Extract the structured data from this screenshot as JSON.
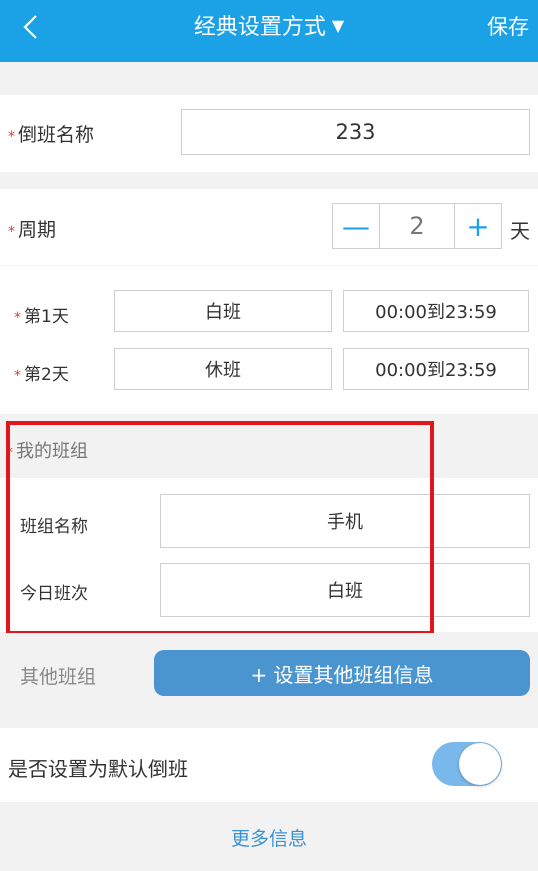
{
  "header": {
    "title": "经典设置方式",
    "title_caret": "▼",
    "save_label": "保存"
  },
  "shift_name": {
    "required_mark": "*",
    "label": "倒班名称",
    "value": "233"
  },
  "cycle": {
    "required_mark": "*",
    "label": "周期",
    "minus": "—",
    "value": "2",
    "plus": "+",
    "unit": "天"
  },
  "days": [
    {
      "required_mark": "*",
      "label": "第1天",
      "shift": "白班",
      "time": "00:00到23:59"
    },
    {
      "required_mark": "*",
      "label": "第2天",
      "shift": "休班",
      "time": "00:00到23:59"
    }
  ],
  "my_team": {
    "required_mark": "*",
    "section_label": "我的班组",
    "name_label": "班组名称",
    "name_value": "手机",
    "today_label": "今日班次",
    "today_value": "白班"
  },
  "other_team": {
    "label": "其他班组",
    "button_label": "+ 设置其他班组信息"
  },
  "default_setting": {
    "label": "是否设置为默认倒班",
    "enabled": true
  },
  "more_info": "更多信息",
  "colors": {
    "header_bg": "#1ba1e6",
    "accent": "#1ba1e6",
    "required": "#e23b3b",
    "highlight_frame": "#e3141c",
    "button_bg": "#4a95cf",
    "toggle_on": "#79b8ea",
    "link": "#3a92d6"
  }
}
